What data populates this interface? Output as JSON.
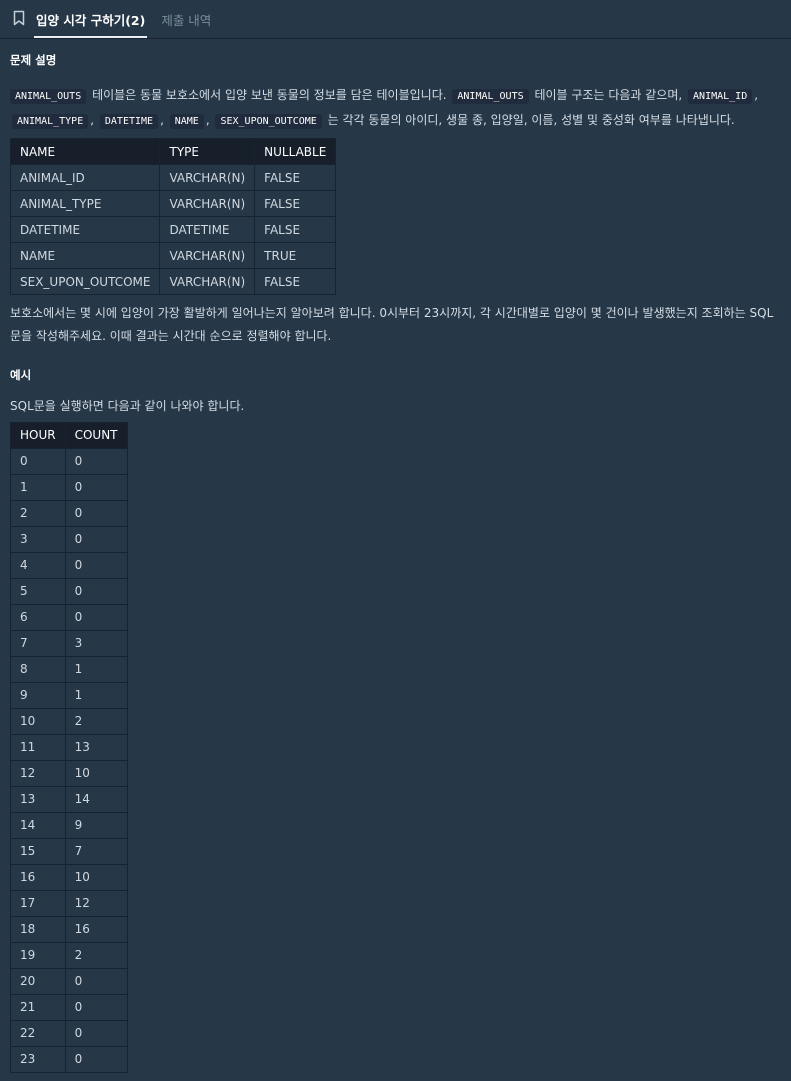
{
  "tabs": [
    {
      "label": "입양 시각 구하기(2)",
      "active": true
    },
    {
      "label": "제출 내역",
      "active": false
    }
  ],
  "section_titles": {
    "description": "문제 설명",
    "example": "예시"
  },
  "intro": {
    "code1": "ANIMAL_OUTS",
    "text1": "테이블은 동물 보호소에서 입양 보낸 동물의 정보를 담은 테이블입니다.",
    "code2": "ANIMAL_OUTS",
    "text2": "테이블 구조는 다음과 같으며,",
    "code3": "ANIMAL_ID",
    "comma": ",",
    "code4": "ANIMAL_TYPE",
    "code5": "DATETIME",
    "code6": "NAME",
    "code7": "SEX_UPON_OUTCOME",
    "text3": "는 각각 동물의 아이디, 생물 종, 입양일, 이름, 성별 및 중성화 여부를 나타냅니다."
  },
  "schema_table": {
    "headers": [
      "NAME",
      "TYPE",
      "NULLABLE"
    ],
    "rows": [
      [
        "ANIMAL_ID",
        "VARCHAR(N)",
        "FALSE"
      ],
      [
        "ANIMAL_TYPE",
        "VARCHAR(N)",
        "FALSE"
      ],
      [
        "DATETIME",
        "DATETIME",
        "FALSE"
      ],
      [
        "NAME",
        "VARCHAR(N)",
        "TRUE"
      ],
      [
        "SEX_UPON_OUTCOME",
        "VARCHAR(N)",
        "FALSE"
      ]
    ]
  },
  "task_text": "보호소에서는 몇 시에 입양이 가장 활발하게 일어나는지 알아보려 합니다. 0시부터 23시까지, 각 시간대별로 입양이 몇 건이나 발생했는지 조회하는 SQL문을 작성해주세요. 이때 결과는 시간대 순으로 정렬해야 합니다.",
  "example_text": "SQL문을 실행하면 다음과 같이 나와야 합니다.",
  "result_table": {
    "headers": [
      "HOUR",
      "COUNT"
    ],
    "rows": [
      [
        "0",
        "0"
      ],
      [
        "1",
        "0"
      ],
      [
        "2",
        "0"
      ],
      [
        "3",
        "0"
      ],
      [
        "4",
        "0"
      ],
      [
        "5",
        "0"
      ],
      [
        "6",
        "0"
      ],
      [
        "7",
        "3"
      ],
      [
        "8",
        "1"
      ],
      [
        "9",
        "1"
      ],
      [
        "10",
        "2"
      ],
      [
        "11",
        "13"
      ],
      [
        "12",
        "10"
      ],
      [
        "13",
        "14"
      ],
      [
        "14",
        "9"
      ],
      [
        "15",
        "7"
      ],
      [
        "16",
        "10"
      ],
      [
        "17",
        "12"
      ],
      [
        "18",
        "16"
      ],
      [
        "19",
        "2"
      ],
      [
        "20",
        "0"
      ],
      [
        "21",
        "0"
      ],
      [
        "22",
        "0"
      ],
      [
        "23",
        "0"
      ]
    ]
  }
}
